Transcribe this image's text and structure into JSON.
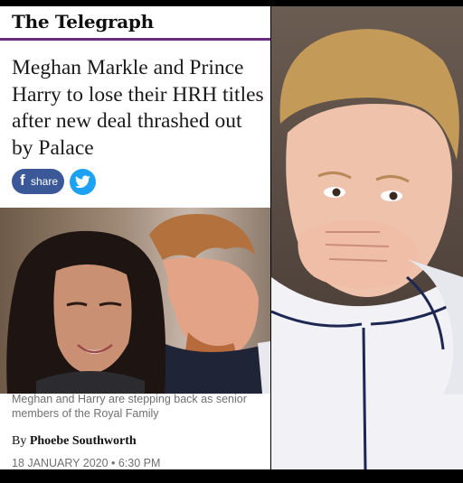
{
  "article": {
    "masthead": "The Telegraph",
    "headline": "Meghan Markle and Prince Harry to lose their HRH titles after new deal thrashed out by Palace",
    "share": {
      "facebook_glyph": "f",
      "facebook_label": "share",
      "facebook_icon": "facebook-icon",
      "twitter_icon": "twitter-bird-icon"
    },
    "photo_caption": "Meghan and Harry are stepping back as senior members of the Royal Family",
    "byline_prefix": "By",
    "author": "Phoebe Southworth",
    "date": "18 JANUARY 2020 • 6:30 PM"
  },
  "colors": {
    "brand_rule": "#6a2e7e",
    "facebook": "#3b5998",
    "twitter": "#1da1f2"
  }
}
